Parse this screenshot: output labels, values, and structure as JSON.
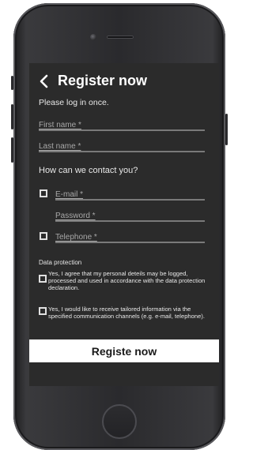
{
  "header": {
    "title": "Register now",
    "back_icon": "chevron-left-icon"
  },
  "subtitle": "Please log in once.",
  "fields": {
    "first_name_placeholder": "First name *",
    "last_name_placeholder": "Last name *",
    "email_placeholder": "E-mail *",
    "password_placeholder": "Password *",
    "telephone_placeholder": "Telephone *"
  },
  "contact_heading": "How can we contact you?",
  "data_protection": {
    "label": "Data protection",
    "consent_1": "Yes, I agree that my personal deteils may be logged, processed and used in accordance with the data protection declaration.",
    "consent_2": "Yes, I would like to receive tailored information via the specified communication channels (e.g. e-mail, telephone)."
  },
  "submit_label": "Registe now",
  "colors": {
    "screen_bg": "#2b2b2b",
    "button_bg": "#ffffff",
    "text": "#f2f2f2"
  }
}
